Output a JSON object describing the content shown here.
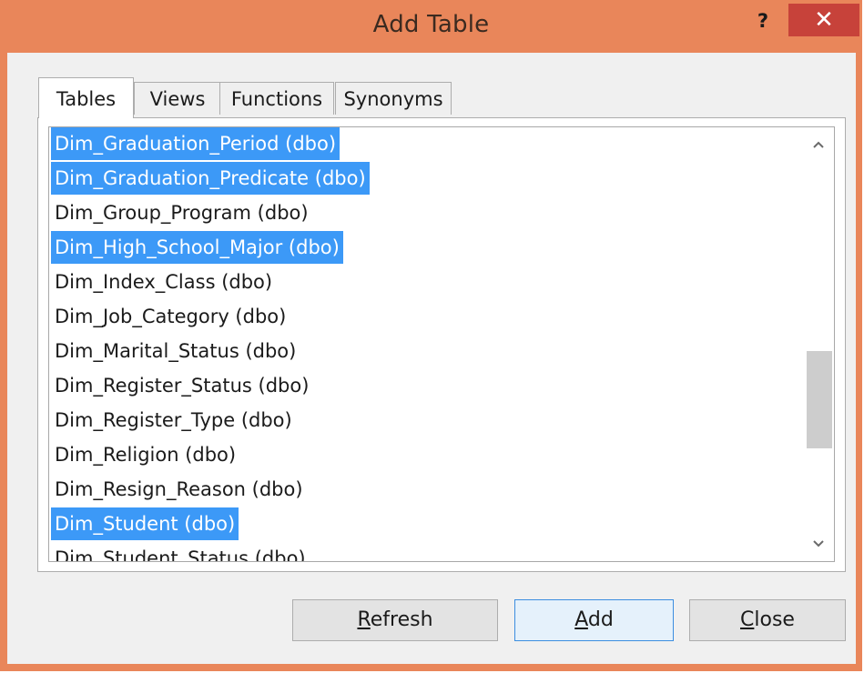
{
  "window": {
    "title": "Add Table",
    "help_label": "?",
    "close_label": "✕"
  },
  "tabs": [
    "Tables",
    "Views",
    "Functions",
    "Synonyms"
  ],
  "active_tab": "Tables",
  "list": {
    "items": [
      {
        "label": "Dim_Graduation_Period (dbo)",
        "selected": true
      },
      {
        "label": "Dim_Graduation_Predicate (dbo)",
        "selected": true
      },
      {
        "label": "Dim_Group_Program (dbo)",
        "selected": false
      },
      {
        "label": "Dim_High_School_Major (dbo)",
        "selected": true
      },
      {
        "label": "Dim_Index_Class (dbo)",
        "selected": false
      },
      {
        "label": "Dim_Job_Category (dbo)",
        "selected": false
      },
      {
        "label": "Dim_Marital_Status (dbo)",
        "selected": false
      },
      {
        "label": "Dim_Register_Status (dbo)",
        "selected": false
      },
      {
        "label": "Dim_Register_Type (dbo)",
        "selected": false
      },
      {
        "label": "Dim_Religion (dbo)",
        "selected": false
      },
      {
        "label": "Dim_Resign_Reason (dbo)",
        "selected": false
      },
      {
        "label": "Dim_Student (dbo)",
        "selected": true
      },
      {
        "label": "Dim_Student_Status (dbo)",
        "selected": false
      }
    ]
  },
  "buttons": {
    "refresh": {
      "first": "R",
      "rest": "efresh"
    },
    "add": {
      "first": "A",
      "rest": "dd"
    },
    "close": {
      "first": "C",
      "rest": "lose"
    }
  },
  "colors": {
    "titlebar": "#e9865a",
    "selection": "#3c99f7",
    "close_button": "#c7423a"
  }
}
